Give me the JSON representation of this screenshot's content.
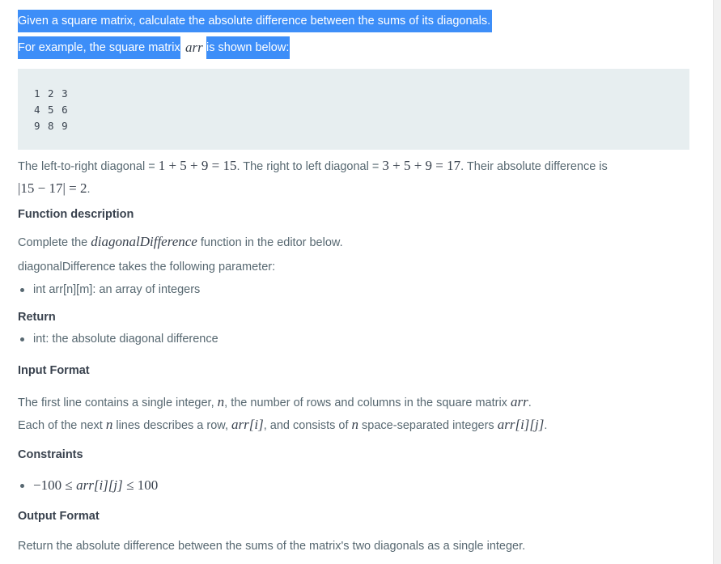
{
  "intro": {
    "line1": "Given a square matrix, calculate the absolute difference between the sums of its diagonals.",
    "line2_pre": "For example, the square matrix",
    "line2_var": "arr",
    "line2_post": "is shown below:"
  },
  "matrix": [
    "1 2 3",
    "4 5 6",
    "9 8 9"
  ],
  "example": {
    "ltr_pre": "The left-to-right diagonal =",
    "ltr_eq": "1 + 5 + 9 = 15",
    "rtl_pre": ". The right to left diagonal =",
    "rtl_eq": "3 + 5 + 9 = 17",
    "diff_pre": ". Their absolute difference is",
    "diff_eq": "|15 − 17| = 2",
    "diff_post": "."
  },
  "function_description": {
    "heading": "Function description",
    "complete_pre": "Complete the",
    "fn_name": "diagonalDifference",
    "complete_post": "function in the editor below.",
    "takes": "diagonalDifference takes the following parameter:",
    "param": "int arr[n][m]: an array of integers"
  },
  "return": {
    "heading": "Return",
    "item": "int: the absolute diagonal difference"
  },
  "input_format": {
    "heading": "Input Format",
    "line1_pre": "The first line contains a single integer,",
    "line1_var": "n",
    "line1_mid": ", the number of rows and columns in the square matrix",
    "line1_var2": "arr",
    "line1_post": ".",
    "line2_pre": "Each of the next",
    "line2_var": "n",
    "line2_mid": "lines describes a row,",
    "line2_var2": "arr[i]",
    "line2_mid2": ", and consists of",
    "line2_var3": "n",
    "line2_mid3": "space-separated integers",
    "line2_var4": "arr[i][j]",
    "line2_post": "."
  },
  "constraints": {
    "heading": "Constraints",
    "item_lo": "−100 ≤",
    "item_var": "arr[i][j]",
    "item_hi": "≤ 100"
  },
  "output_format": {
    "heading": "Output Format",
    "text": "Return the absolute difference between the sums of the matrix's two diagonals as a single integer."
  },
  "colors": {
    "selection": "#3d8ef8",
    "code_bg": "#e7eef0",
    "body_text": "#576871",
    "heading_text": "#39424e"
  }
}
